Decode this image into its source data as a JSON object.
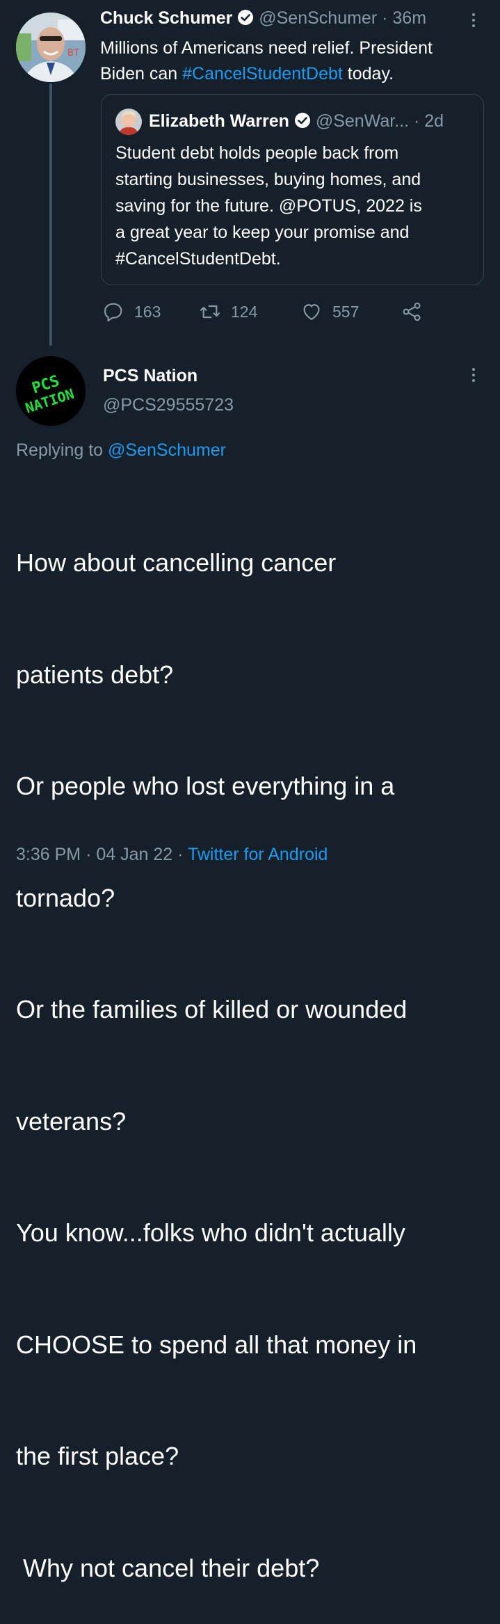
{
  "tweet1": {
    "display_name": "Chuck Schumer",
    "handle": "@SenSchumer",
    "separator": "·",
    "time": "36m",
    "text_line1": "Millions of Americans need relief. President",
    "text_line2_prefix": "Biden can ",
    "hashtag": "#CancelStudentDebt",
    "text_line2_suffix": " today.",
    "quoted": {
      "display_name": "Elizabeth Warren",
      "handle": "@SenWar...",
      "separator": "·",
      "time": "2d",
      "lines": [
        "Student debt holds people back from",
        "starting businesses, buying homes, and",
        "saving for the future. @POTUS, 2022 is",
        "a great year to keep your promise and",
        "#CancelStudentDebt."
      ]
    },
    "actions": {
      "replies": "163",
      "retweets": "124",
      "likes": "557"
    }
  },
  "tweet2": {
    "display_name": "PCS Nation",
    "handle": "@PCS29555723",
    "avatar_text_line1": "PCS",
    "avatar_text_line2": "NATION",
    "replying_prefix": "Replying to ",
    "replying_handle": "@SenSchumer",
    "body_lines": [
      "How about cancelling cancer",
      "patients debt?",
      "Or people who lost everything in a",
      "tornado?",
      "Or the families of killed or wounded",
      "veterans?",
      "You know...folks who didn't actually",
      "CHOOSE to spend all that money in",
      "the first place?",
      " Why not cancel their debt?"
    ],
    "time": "3:36 PM",
    "sep1": "·",
    "date": "04 Jan 22",
    "sep2": "·",
    "client": "Twitter for Android"
  },
  "colors": {
    "background": "#15202b",
    "accent": "#1d9bf0",
    "secondary_text": "#8b98a5",
    "border": "#38444d",
    "avatar_green": "#22e03b"
  }
}
